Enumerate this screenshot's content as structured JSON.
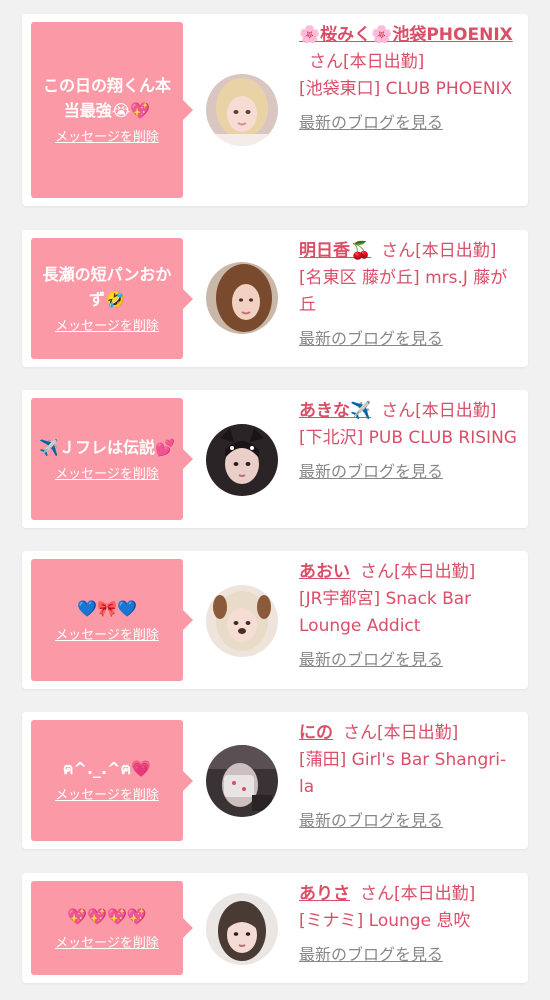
{
  "colors": {
    "background": "#f1f1f1",
    "card": "#ffffff",
    "bubble": "#fb9aa6",
    "accent_text": "#d94f68",
    "link_gray": "#888888"
  },
  "delete_label": "メッセージを削除",
  "blog_label": "最新のブログを見る",
  "entries": [
    {
      "message": "この日の翔くん本当最強😭💖",
      "delete_label": "メッセージを削除",
      "name": "🌸桜みく🌸池袋PHOENIX",
      "suffix": "さん[本日出勤]",
      "shop": "[池袋東口] CLUB PHOENIX",
      "blog_label": "最新のブログを見る",
      "avatar_icon": "girl-portrait-blonde"
    },
    {
      "message": "長瀬の短パンおかず🤣",
      "delete_label": "メッセージを削除",
      "name": "明日香🍒",
      "suffix": "さん[本日出勤]",
      "shop": "[名東区 藤が丘] mrs.J 藤が丘",
      "blog_label": "最新のブログを見る",
      "avatar_icon": "woman-portrait-brown-hair"
    },
    {
      "message": "✈️Ｊフレは伝説💕",
      "delete_label": "メッセージを削除",
      "name": "あきな✈️",
      "suffix": "さん[本日出勤]",
      "shop": "[下北沢] PUB CLUB RISING",
      "blog_label": "最新のブログを見る",
      "avatar_icon": "girl-portrait-cat-ears"
    },
    {
      "message": "💙🎀💙",
      "delete_label": "メッセージを削除",
      "name": "あおい",
      "suffix": "さん[本日出勤]",
      "shop": "[JR宇都宮] Snack Bar Lounge Addict",
      "blog_label": "最新のブログを見る",
      "avatar_icon": "girl-portrait-dog-filter"
    },
    {
      "message": "ฅ^._.^ฅ💗",
      "delete_label": "メッセージを削除",
      "name": "にの",
      "suffix": "さん[本日出勤]",
      "shop": "[蒲田] Girl's Bar Shangri-la",
      "blog_label": "最新のブログを見る",
      "avatar_icon": "girl-portrait-dark-mask"
    },
    {
      "message": "💖💖💖💖",
      "delete_label": "メッセージを削除",
      "name": "ありさ",
      "suffix": "さん[本日出勤]",
      "shop": "[ミナミ] Lounge 息吹",
      "blog_label": "最新のブログを見る",
      "avatar_icon": "girl-portrait-bangs"
    }
  ]
}
